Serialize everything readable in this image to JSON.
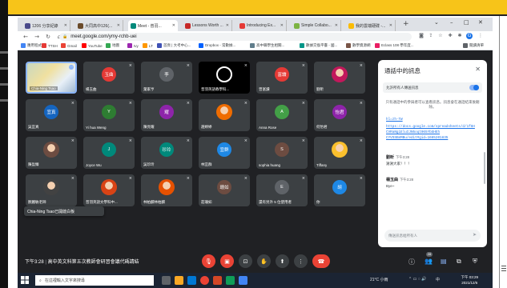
{
  "browser": {
    "tabs": [
      {
        "label": "1206 分享紀錄",
        "color": "#4a4a8a"
      },
      {
        "label": "大同高中126(...",
        "color": "#6a4a2a"
      },
      {
        "label": "Meet - 普羽...",
        "color": "#00897b",
        "active": true
      },
      {
        "label": "Lessons Worth ...",
        "color": "#c62828"
      },
      {
        "label": "Introducing Ex...",
        "color": "#e53935"
      },
      {
        "label": "Simple Collabo...",
        "color": "#7cb342"
      },
      {
        "label": "我的雲端硬碟 -...",
        "color": "#fbbc04"
      }
    ],
    "url": "meet.google.com/ymy-rchb-uei",
    "bookmarks": [
      {
        "label": "應用程式",
        "color": "#4285f4"
      },
      {
        "label": "TTSH",
        "color": "#e53935"
      },
      {
        "label": "Gmail",
        "color": "#ea4335"
      },
      {
        "label": "YouTube",
        "color": "#ff0000"
      },
      {
        "label": "地圖",
        "color": "#34a853"
      },
      {
        "label": "Ivy",
        "color": "#9c27b0"
      },
      {
        "label": "LT",
        "color": "#ff9800"
      },
      {
        "label": "首頁 | 大考中心...",
        "color": "#3f51b5"
      },
      {
        "label": "Dropbox - 常數據...",
        "color": "#0061ff"
      },
      {
        "label": "高中職學生相關...",
        "color": "#607d8b"
      },
      {
        "label": "數據交換平臺 - 國...",
        "color": "#009688"
      },
      {
        "label": "數學資源網",
        "color": "#795548"
      },
      {
        "label": "Eclass 108 學年度...",
        "color": "#e91e63"
      },
      {
        "label": "閱讀清單",
        "color": "#5f6368"
      }
    ]
  },
  "tiles": [
    {
      "name": "Chia-Ning Tsao",
      "type": "self"
    },
    {
      "name": "楊玉曲",
      "avatar": "玉曲",
      "color": "#e53935"
    },
    {
      "name": "葉家亨",
      "avatar": "李",
      "color": "#5f6368"
    },
    {
      "name": "普羽英語教學科...",
      "type": "logo"
    },
    {
      "name": "曾富讀",
      "avatar": "富讀",
      "color": "#e53935"
    },
    {
      "name": "劉昕",
      "type": "photo",
      "color": "#c2185b"
    },
    {
      "name": "吳宜真",
      "avatar": "宜真",
      "color": "#1565c0"
    },
    {
      "name": "Yi hua Weng",
      "avatar": "Y",
      "color": "#2e7d32"
    },
    {
      "name": "陳亮耀",
      "avatar": "耀",
      "color": "#8e24aa"
    },
    {
      "name": "趙婷婷",
      "type": "photo",
      "color": "#ef6c00"
    },
    {
      "name": "Anna Rose",
      "avatar": "A",
      "color": "#43a047"
    },
    {
      "name": "何怡君",
      "avatar": "怡君",
      "color": "#8e24aa"
    },
    {
      "name": "陳盈臻",
      "type": "photo",
      "color": "#6d4c41"
    },
    {
      "name": "Joyce Wu",
      "avatar": "J",
      "color": "#00897b"
    },
    {
      "name": "吳珍玲",
      "avatar": "珍玲",
      "color": "#00897b"
    },
    {
      "name": "林宜群",
      "avatar": "宜群",
      "color": "#1e88e5"
    },
    {
      "name": "sophia huang",
      "avatar": "S",
      "color": "#6d4c41"
    },
    {
      "name": "Tiffany",
      "type": "photo",
      "color": "#fbc02d"
    },
    {
      "name": "顏麗敏老師",
      "type": "photo",
      "color": "#424242"
    },
    {
      "name": "普羽英語文學科中...",
      "type": "photo",
      "color": "#d84315"
    },
    {
      "name": "林柏麟林柏麟",
      "type": "photo",
      "color": "#e65100"
    },
    {
      "name": "莊珊如",
      "avatar": "珊如",
      "color": "#6d4c41"
    },
    {
      "name": "還有另外 5 位使用者",
      "avatar": "E",
      "color": "#5f6368"
    },
    {
      "name": "你",
      "avatar": "胡",
      "color": "#1e88e5"
    }
  ],
  "toast": "Chia-Ning Tsao已開啟白板",
  "chat": {
    "title": "通話中的訊息",
    "allow_label": "允許所有人傳送訊息",
    "notice": "只有通話中的參與者可以查看訊息。訊息會在通話結束後刪除。",
    "links": [
      "hl=zh-TW",
      "https://docs.google.com/spreadsheets/d/1fGH",
      "CVRaNgiEluIJN5oqt065YbGHEh",
      "CYVSSEmMBu/edit#gid=1665201835"
    ],
    "messages": [
      {
        "sender": "劉昕",
        "time": "下午3:28",
        "text": "謝謝大家！！！"
      },
      {
        "sender": "楊玉曲",
        "time": "下午3:28",
        "text": "Bye~"
      }
    ],
    "input_placeholder": "傳送訊息給所有人"
  },
  "controls": {
    "time": "下午3:28",
    "meeting": "高中英文科第五次教師會研習會議代碼請結",
    "chat_badge": "28"
  },
  "taskbar": {
    "search_placeholder": "在這裡輸入文字來搜尋",
    "weather": "21°C 小雨",
    "ime": "中",
    "time": "下午 03:29",
    "date": "2021/12/6"
  }
}
